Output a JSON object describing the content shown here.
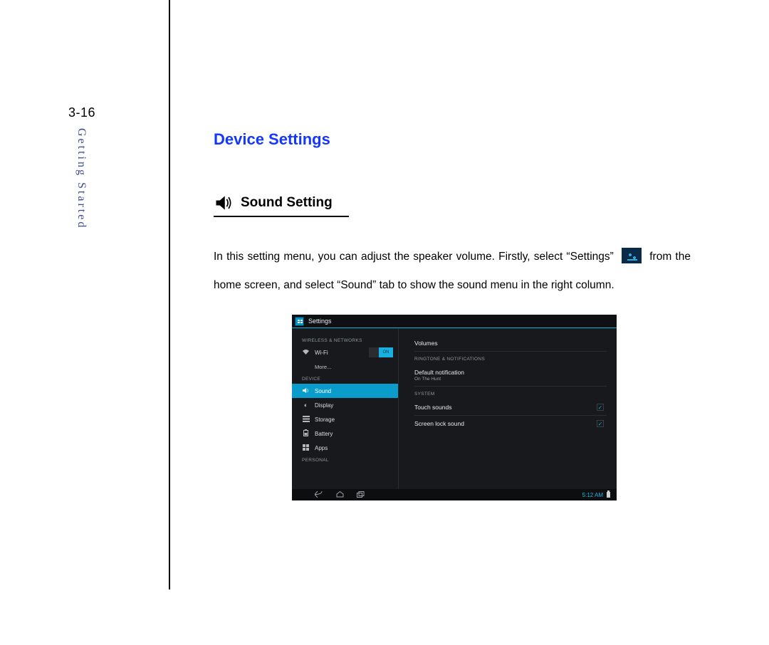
{
  "page_number": "3-16",
  "section_label": "Getting Started",
  "heading": "Device Settings",
  "subheading": "Sound Setting",
  "paragraph_part1": "In this setting menu, you can adjust the speaker volume. Firstly, select “Settings”",
  "paragraph_part2": "from the home screen, and select “Sound” tab to show the sound menu in the right column.",
  "screenshot": {
    "app_title": "Settings",
    "sidebar": {
      "cat_wireless": "WIRELESS & NETWORKS",
      "wifi": {
        "label": "Wi-Fi",
        "toggle": "ON"
      },
      "more": "More...",
      "cat_device": "DEVICE",
      "sound": "Sound",
      "display": "Display",
      "storage": "Storage",
      "battery": "Battery",
      "apps": "Apps",
      "cat_personal": "PERSONAL"
    },
    "main": {
      "volumes": "Volumes",
      "cat_ringtone": "RINGTONE & NOTIFICATIONS",
      "default_notification": "Default notification",
      "default_notification_sub": "On The Hunt",
      "cat_system": "SYSTEM",
      "touch_sounds": "Touch sounds",
      "screen_lock_sound": "Screen lock sound"
    },
    "navbar": {
      "time": "5:12 AM"
    }
  }
}
